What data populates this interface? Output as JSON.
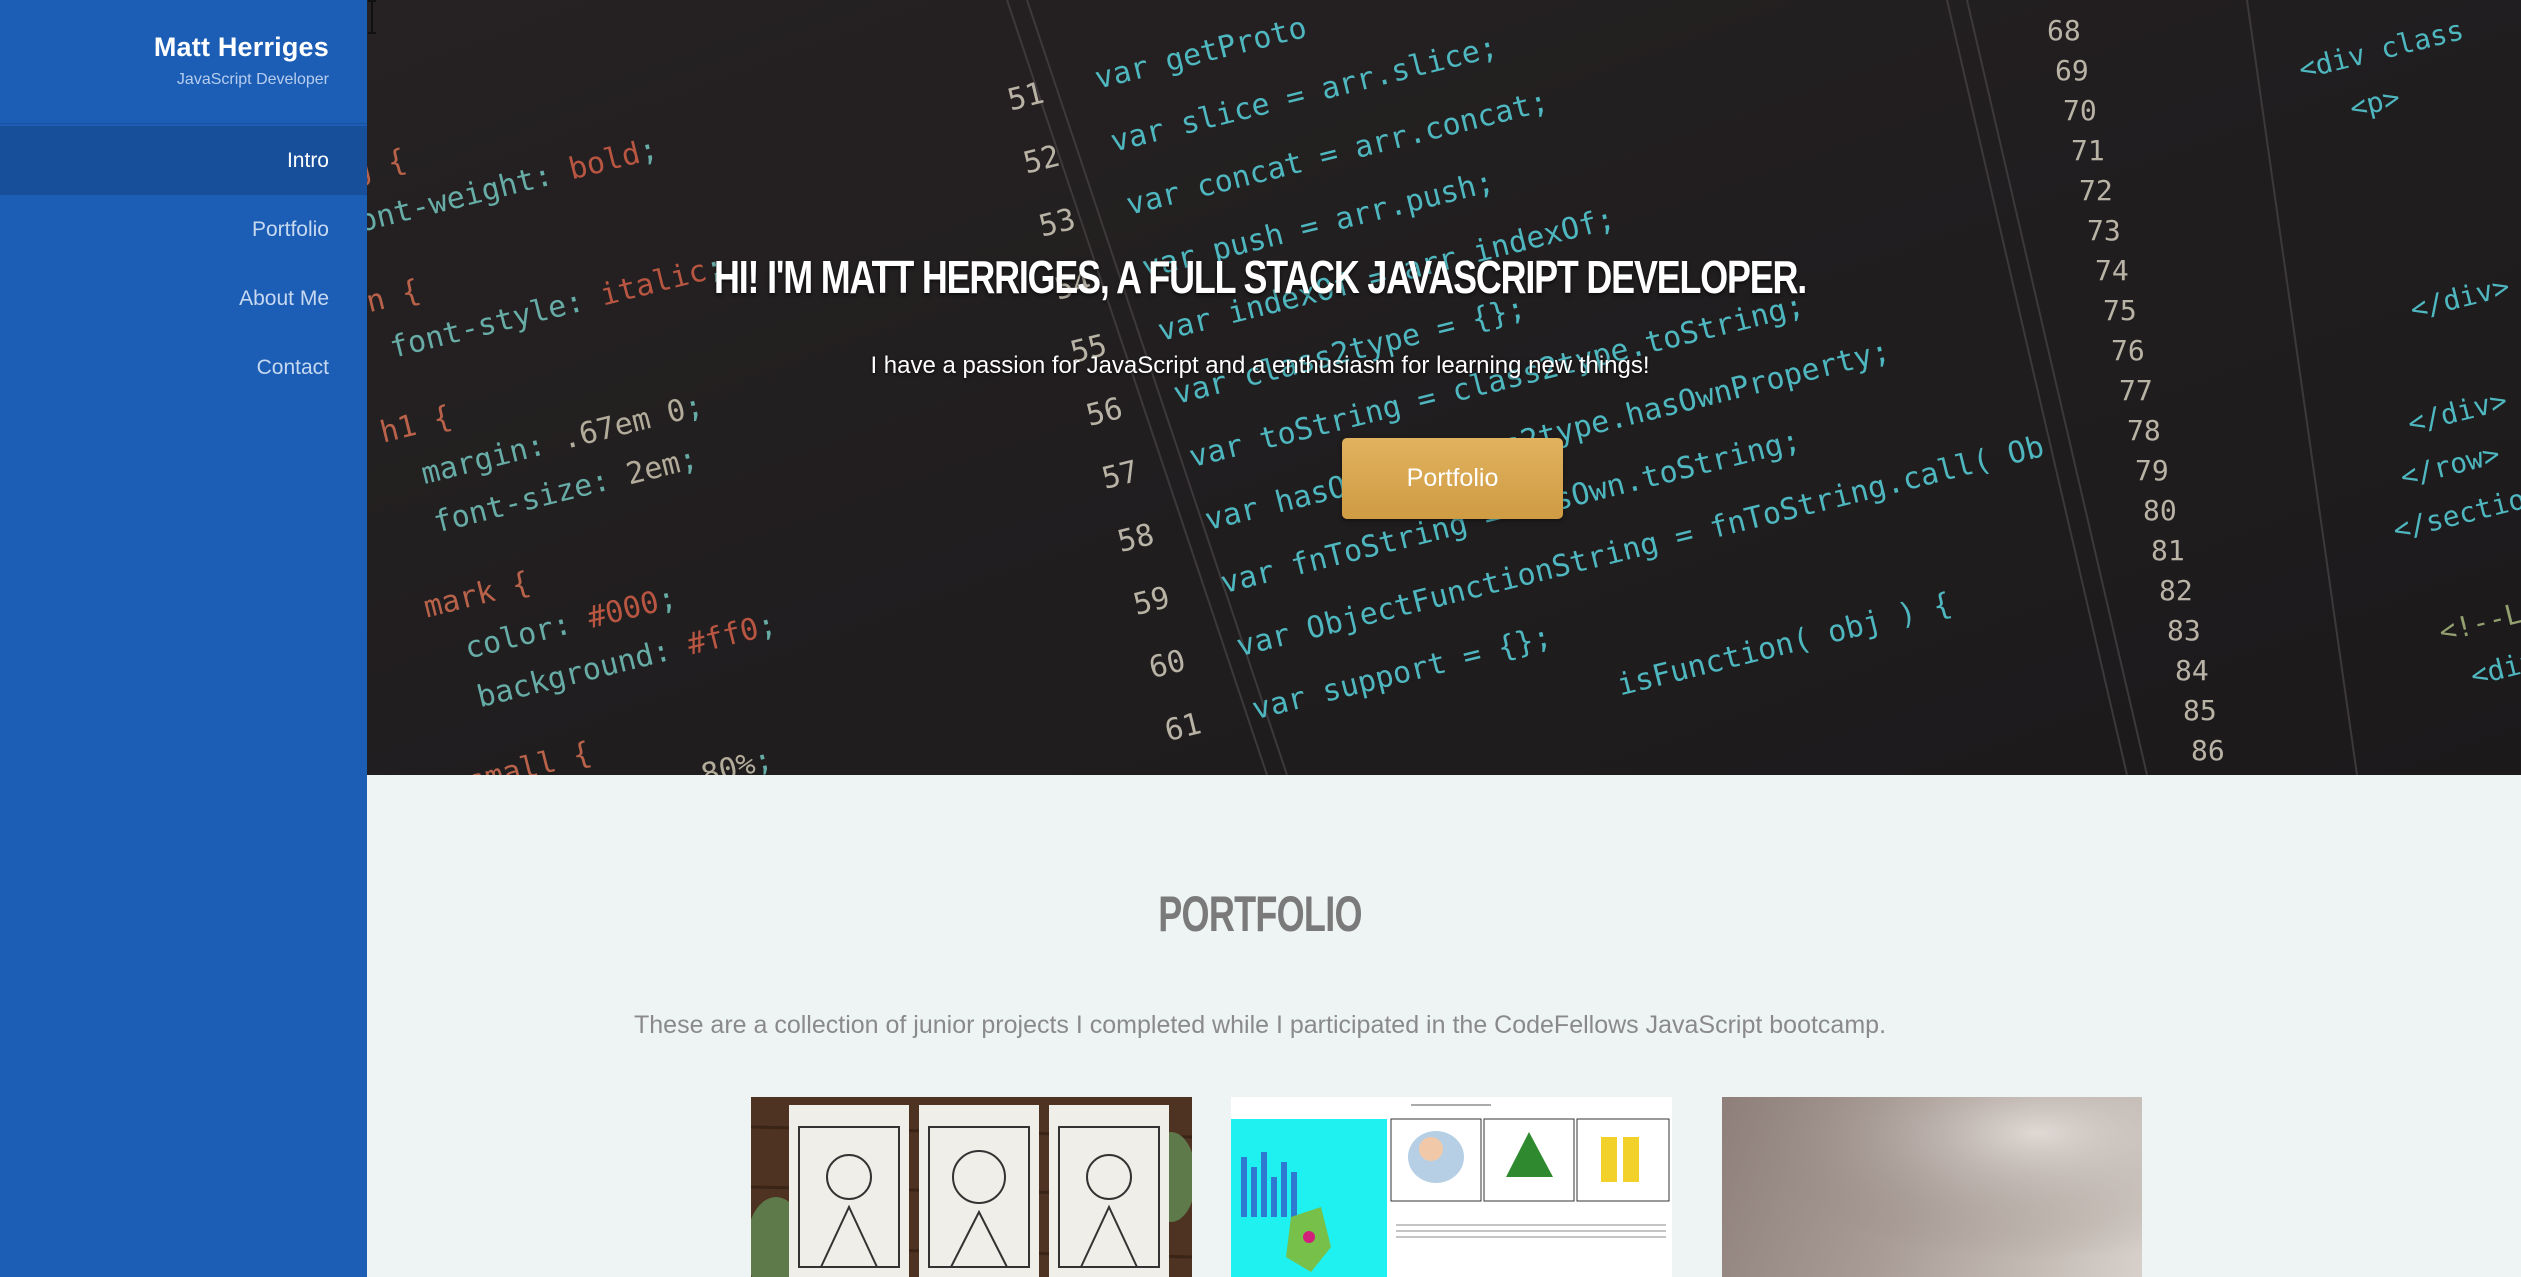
{
  "sidebar": {
    "name": "Matt Herriges",
    "subtitle": "JavaScript Developer",
    "nav": [
      {
        "label": "Intro",
        "active": true
      },
      {
        "label": "Portfolio",
        "active": false
      },
      {
        "label": "About Me",
        "active": false
      },
      {
        "label": "Contact",
        "active": false
      }
    ]
  },
  "hero": {
    "title": "Hi! I'm Matt Herriges, a Full Stack JavaScript Developer.",
    "subtitle": "I have a passion for JavaScript and a enthusiasm for learning new things!",
    "button_label": "Portfolio",
    "button_color": "#d9a94f"
  },
  "portfolio": {
    "title": "Portfolio",
    "description": "These are a collection of junior projects I completed while I participated in the CodeFellows JavaScript bootcamp.",
    "cards": [
      {
        "icon": "tarot-cards-thumbnail"
      },
      {
        "icon": "bus-mall-thumbnail"
      },
      {
        "icon": "blurred-photo-thumbnail"
      }
    ]
  },
  "colors": {
    "sidebar": "#1c5eb5",
    "sidebar_active": "#174f9b",
    "page_bg": "#eef4f4",
    "accent": "#d9a94f"
  }
}
